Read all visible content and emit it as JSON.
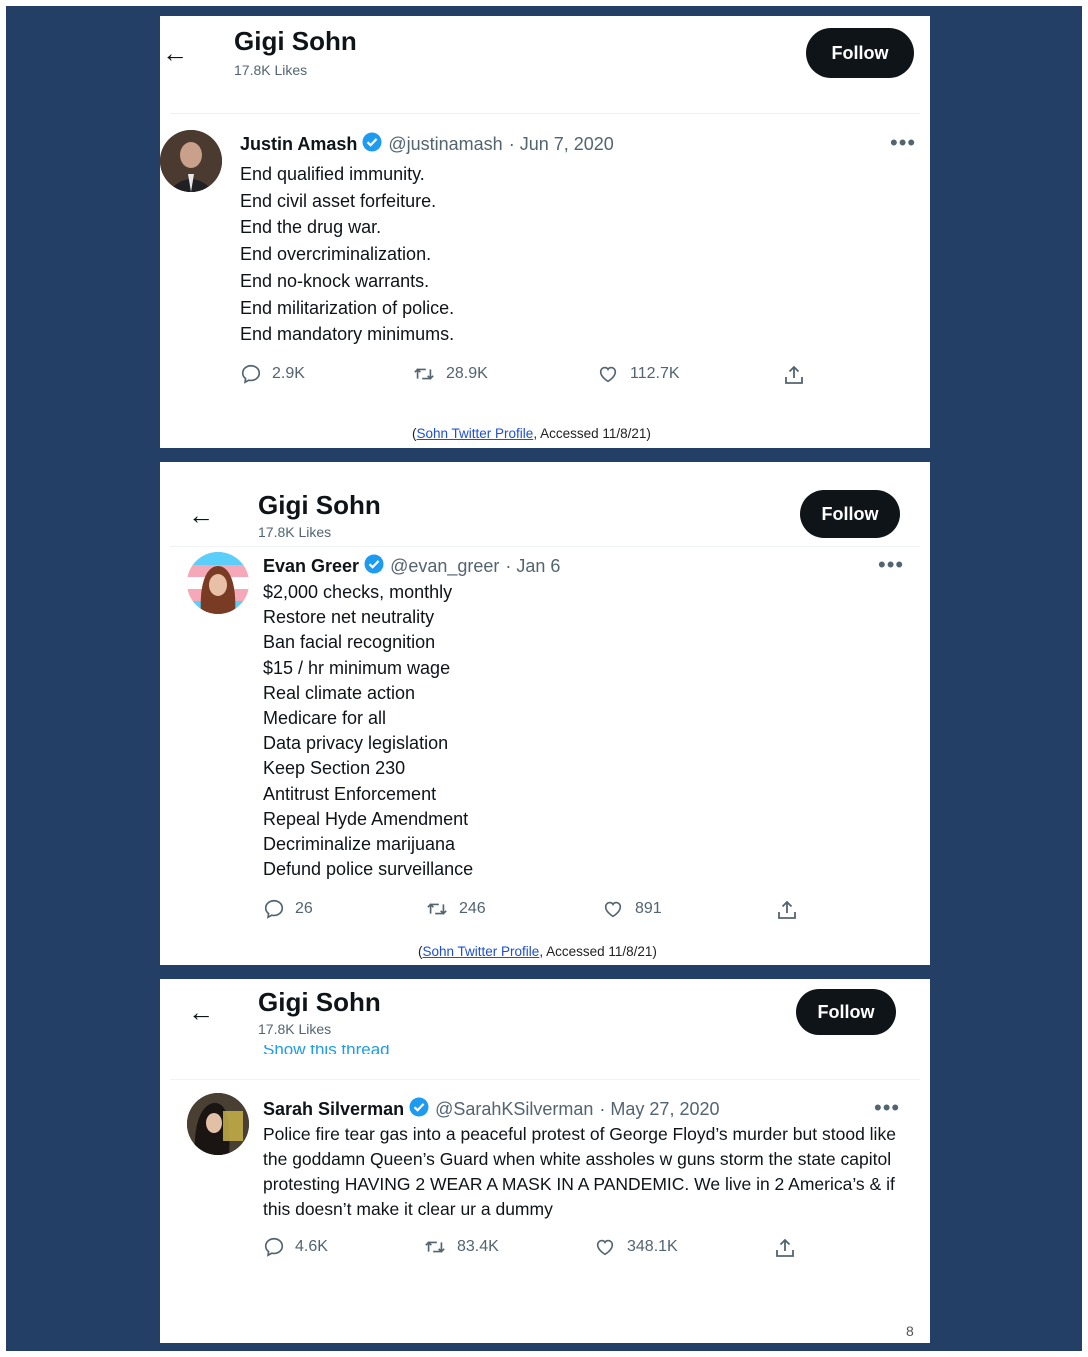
{
  "panels": [
    {
      "profile": {
        "name": "Gigi Sohn",
        "likes": "17.8K Likes",
        "follow_label": "Follow"
      },
      "tweet": {
        "author": "Justin Amash",
        "handle": "@justinamash",
        "date": "· Jun 7, 2020",
        "lines": [
          "End qualified immunity.",
          "End civil asset forfeiture.",
          "End the drug war.",
          "End overcriminalization.",
          "End no-knock warrants.",
          "End militarization of police.",
          "End mandatory minimums."
        ],
        "replies": "2.9K",
        "retweets": "28.9K",
        "likes": "112.7K"
      },
      "citation": {
        "open": "(",
        "link": "Sohn Twitter Profile",
        "rest": ", Accessed 11/8/21)"
      }
    },
    {
      "profile": {
        "name": "Gigi Sohn",
        "likes": "17.8K Likes",
        "follow_label": "Follow"
      },
      "tweet": {
        "author": "Evan Greer",
        "handle": "@evan_greer",
        "date": "· Jan 6",
        "lines": [
          "$2,000 checks, monthly",
          "Restore net neutrality",
          "Ban facial recognition",
          "$15 / hr minimum wage",
          "Real climate action",
          "Medicare for all",
          "Data privacy legislation",
          "Keep Section 230",
          "Antitrust Enforcement",
          "Repeal Hyde Amendment",
          "Decriminalize marijuana",
          "Defund police surveillance"
        ],
        "replies": "26",
        "retweets": "246",
        "likes": "891"
      },
      "citation": {
        "open": "(",
        "link": "Sohn Twitter Profile",
        "rest": ", Accessed 11/8/21)"
      }
    },
    {
      "profile": {
        "name": "Gigi Sohn",
        "likes": "17.8K Likes",
        "follow_label": "Follow"
      },
      "peek_text": "Show this thread",
      "tweet": {
        "author": "Sarah Silverman",
        "handle": "@SarahKSilverman",
        "date": "· May 27, 2020",
        "text": "Police fire tear gas into a peaceful protest of George Floyd’s murder but stood like the goddamn Queen’s Guard when white assholes w guns storm the state capitol protesting HAVING 2 WEAR A MASK IN A PANDEMIC. We live in 2 America’s & if this doesn’t make it clear ur a dummy",
        "replies": "4.6K",
        "retweets": "83.4K",
        "likes": "348.1K"
      }
    }
  ],
  "page_number": "8",
  "colors": {
    "slide_bg": "#243f66",
    "verified": "#1d9bf0",
    "follow_bg": "#0f1419"
  },
  "icons": [
    "back-arrow-icon",
    "verified-badge-icon",
    "more-icon",
    "reply-icon",
    "retweet-icon",
    "like-icon",
    "share-icon"
  ]
}
